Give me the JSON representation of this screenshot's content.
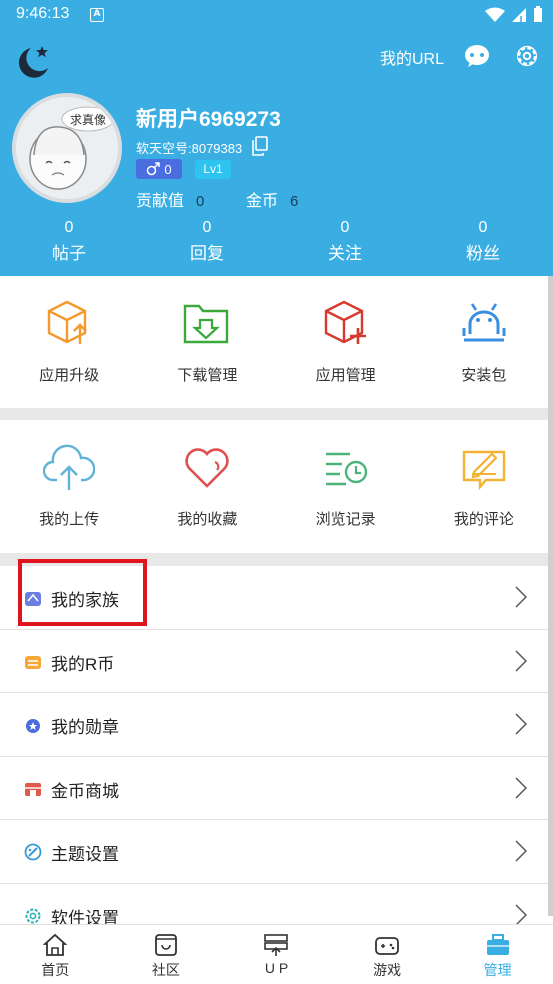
{
  "status": {
    "time": "9:46:13",
    "notif": "A"
  },
  "header": {
    "url_label": "我的URL",
    "username": "新用户6969273",
    "uid": "软天空号:8079383",
    "gender_count": "0",
    "level": "Lv1",
    "contribution_label": "贡献值",
    "contribution_value": "0",
    "coins_label": "金币",
    "coins_value": "6",
    "avatar_caption": "求真像"
  },
  "counts": [
    {
      "num": "0",
      "label": "帖子"
    },
    {
      "num": "0",
      "label": "回复"
    },
    {
      "num": "0",
      "label": "关注"
    },
    {
      "num": "0",
      "label": "粉丝"
    }
  ],
  "grid1": [
    {
      "label": "应用升级"
    },
    {
      "label": "下载管理"
    },
    {
      "label": "应用管理"
    },
    {
      "label": "安装包"
    }
  ],
  "grid2": [
    {
      "label": "我的上传"
    },
    {
      "label": "我的收藏"
    },
    {
      "label": "浏览记录"
    },
    {
      "label": "我的评论"
    }
  ],
  "list": [
    {
      "label": "我的家族"
    },
    {
      "label": "我的R币"
    },
    {
      "label": "我的勋章"
    },
    {
      "label": "金币商城"
    },
    {
      "label": "主题设置"
    },
    {
      "label": "软件设置"
    }
  ],
  "nav": [
    {
      "label": "首页"
    },
    {
      "label": "社区"
    },
    {
      "label": "U P"
    },
    {
      "label": "游戏"
    },
    {
      "label": "管理"
    }
  ],
  "colors": {
    "primary": "#3aaee3",
    "highlight": "#e0141c"
  }
}
